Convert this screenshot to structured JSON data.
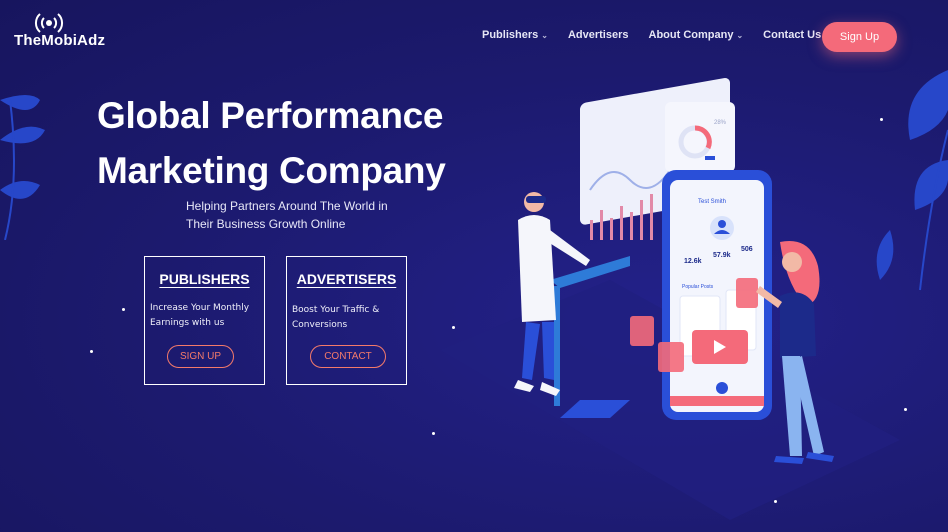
{
  "brand": {
    "name": "TheMobiAdz",
    "logo_icon": "broadcast-signal-icon"
  },
  "nav": {
    "items": [
      {
        "label": "Publishers",
        "has_dropdown": true
      },
      {
        "label": "Advertisers",
        "has_dropdown": false
      },
      {
        "label": "About Company",
        "has_dropdown": true
      },
      {
        "label": "Contact Us",
        "has_dropdown": false
      }
    ],
    "signup_label": "Sign Up"
  },
  "hero": {
    "title_line1": "Global Performance",
    "title_line2": "Marketing Company",
    "subtitle_line1": "Helping Partners Around The World in",
    "subtitle_line2": "Their Business Growth Online"
  },
  "cards": {
    "publishers": {
      "title": "PUBLISHERS",
      "desc_line1": "Increase Your Monthly",
      "desc_line2": "Earnings with us",
      "button": "SIGN UP"
    },
    "advertisers": {
      "title": "ADVERTISERS",
      "desc_line1": "Boost Your Traffic &",
      "desc_line2": "Conversions",
      "button": "CONTACT"
    }
  },
  "illustration": {
    "profile_name": "Test Smith",
    "stats": [
      "12.6k",
      "57.9k",
      "506"
    ],
    "section_label": "Popular Posts",
    "donut_label": "28%"
  },
  "colors": {
    "background": "#1c1a6e",
    "accent": "#f46a7a",
    "outline_button": "#f47a6a",
    "phone_blue": "#2a4fd8"
  }
}
